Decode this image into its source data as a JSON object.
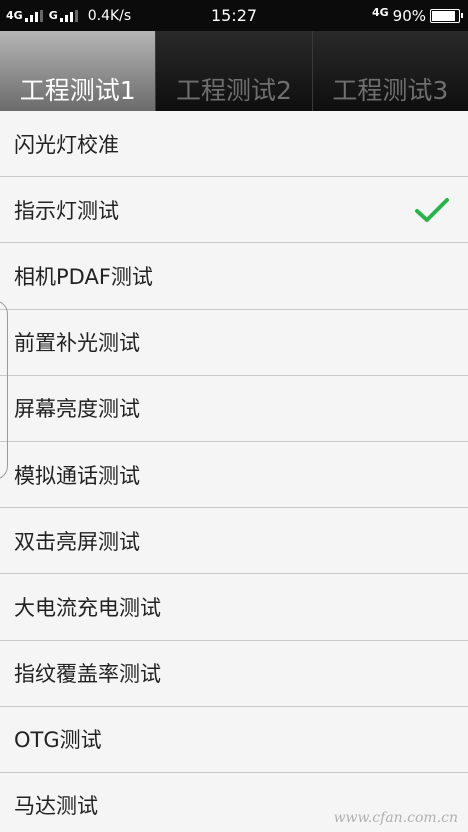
{
  "status_bar": {
    "network_left_1": "4G",
    "network_left_2": "G",
    "speed": "0.4K/s",
    "time": "15:27",
    "network_right": "4G",
    "battery": "90%",
    "battery_level": 0.9
  },
  "tabs": [
    {
      "label": "工程测试1",
      "active": true
    },
    {
      "label": "工程测试2",
      "active": false
    },
    {
      "label": "工程测试3",
      "active": false
    }
  ],
  "items": [
    {
      "label": "闪光灯校准",
      "checked": false
    },
    {
      "label": "指示灯测试",
      "checked": true
    },
    {
      "label": "相机PDAF测试",
      "checked": false
    },
    {
      "label": "前置补光测试",
      "checked": false
    },
    {
      "label": "屏幕亮度测试",
      "checked": false
    },
    {
      "label": "模拟通话测试",
      "checked": false
    },
    {
      "label": "双击亮屏测试",
      "checked": false
    },
    {
      "label": "大电流充电测试",
      "checked": false
    },
    {
      "label": "指纹覆盖率测试",
      "checked": false
    },
    {
      "label": "OTG测试",
      "checked": false
    },
    {
      "label": "马达测试",
      "checked": false
    }
  ],
  "colors": {
    "check": "#2bb24c"
  },
  "watermark": "www.cfan.com.cn"
}
